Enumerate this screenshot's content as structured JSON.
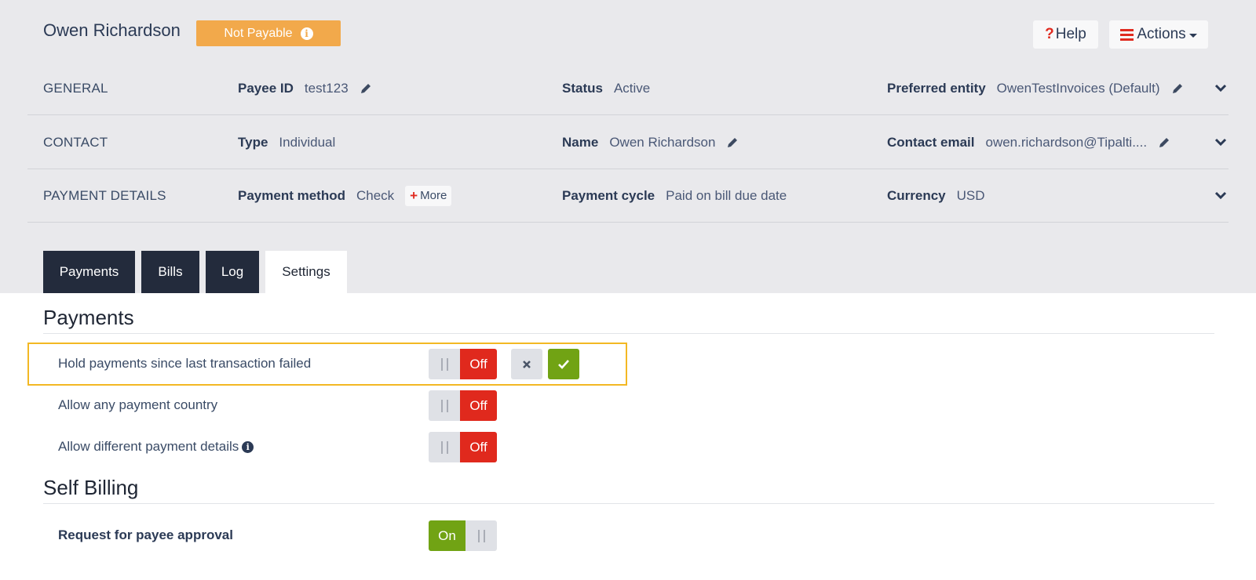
{
  "header": {
    "payee_name": "Owen Richardson",
    "status_badge": "Not Payable",
    "help_label": "Help",
    "actions_label": "Actions"
  },
  "details": {
    "general": {
      "section": "GENERAL",
      "payee_id_label": "Payee ID",
      "payee_id_value": "test123",
      "status_label": "Status",
      "status_value": "Active",
      "entity_label": "Preferred entity",
      "entity_value": "OwenTestInvoices (Default)"
    },
    "contact": {
      "section": "CONTACT",
      "type_label": "Type",
      "type_value": "Individual",
      "name_label": "Name",
      "name_value": "Owen Richardson",
      "email_label": "Contact email",
      "email_value": "owen.richardson@Tipalti...."
    },
    "payment": {
      "section": "PAYMENT DETAILS",
      "method_label": "Payment method",
      "method_value": "Check",
      "more_label": "More",
      "cycle_label": "Payment cycle",
      "cycle_value": "Paid on bill due date",
      "currency_label": "Currency",
      "currency_value": "USD"
    }
  },
  "tabs": [
    {
      "label": "Payments",
      "active": false
    },
    {
      "label": "Bills",
      "active": false
    },
    {
      "label": "Log",
      "active": false
    },
    {
      "label": "Settings",
      "active": true
    }
  ],
  "settings": {
    "payments_title": "Payments",
    "hold_label": "Hold payments since last transaction failed",
    "hold_state": "Off",
    "country_label": "Allow any payment country",
    "country_state": "Off",
    "details_label": "Allow different payment details",
    "details_state": "Off",
    "self_billing_title": "Self Billing",
    "approval_label": "Request for payee approval",
    "approval_state": "On"
  },
  "colors": {
    "badge": "#f2a94b",
    "off": "#e0291d",
    "on": "#71a314",
    "highlight": "#f3b823",
    "tab_dark": "#232b3c"
  }
}
